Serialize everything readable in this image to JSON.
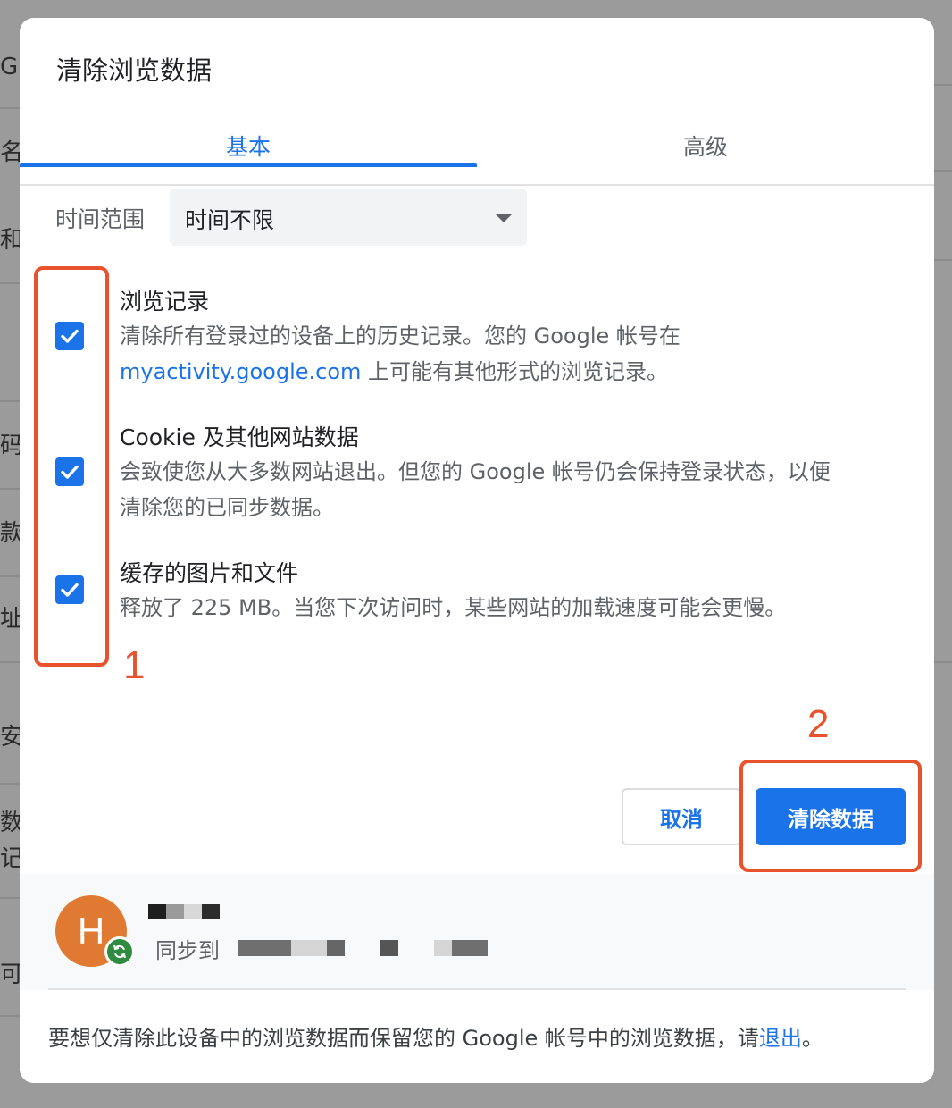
{
  "background_edge": [
    "G",
    "名称",
    "和",
    "码",
    "款",
    "址",
    "安",
    "数",
    "记",
    "可"
  ],
  "dialog": {
    "title": "清除浏览数据",
    "tabs": [
      {
        "label": "基本",
        "active": true
      },
      {
        "label": "高级",
        "active": false
      }
    ],
    "time_range": {
      "label": "时间范围",
      "value": "时间不限"
    },
    "items": [
      {
        "title": "浏览记录",
        "desc_line1": "清除所有登录过的设备上的历史记录。您的 Google 帐号在",
        "link": "myactivity.google.com",
        "desc_line2_suffix": " 上可能有其他形式的浏览记录。",
        "checked": true
      },
      {
        "title": "Cookie 及其他网站数据",
        "desc_line1": "会致使您从大多数网站退出。但您的 Google 帐号仍会保持登录状态，以便",
        "desc_line2": "清除您的已同步数据。",
        "checked": true
      },
      {
        "title": "缓存的图片和文件",
        "desc_line1": "释放了 225 MB。当您下次访问时，某些网站的加载速度可能会更慢。",
        "checked": true
      }
    ],
    "annotations": {
      "one": "1",
      "two": "2"
    },
    "buttons": {
      "cancel": "取消",
      "clear": "清除数据"
    },
    "account": {
      "avatar_letter": "H",
      "sync_label": "同步到"
    },
    "footer": {
      "text_before": "要想仅清除此设备中的浏览数据而保留您的 Google 帐号中的浏览数据，请",
      "link": "退出",
      "text_after": "。"
    }
  },
  "colors": {
    "accent": "#1a73e8",
    "annotation": "#e8532d",
    "avatar": "#e07a33",
    "sync": "#2e8b3f"
  }
}
